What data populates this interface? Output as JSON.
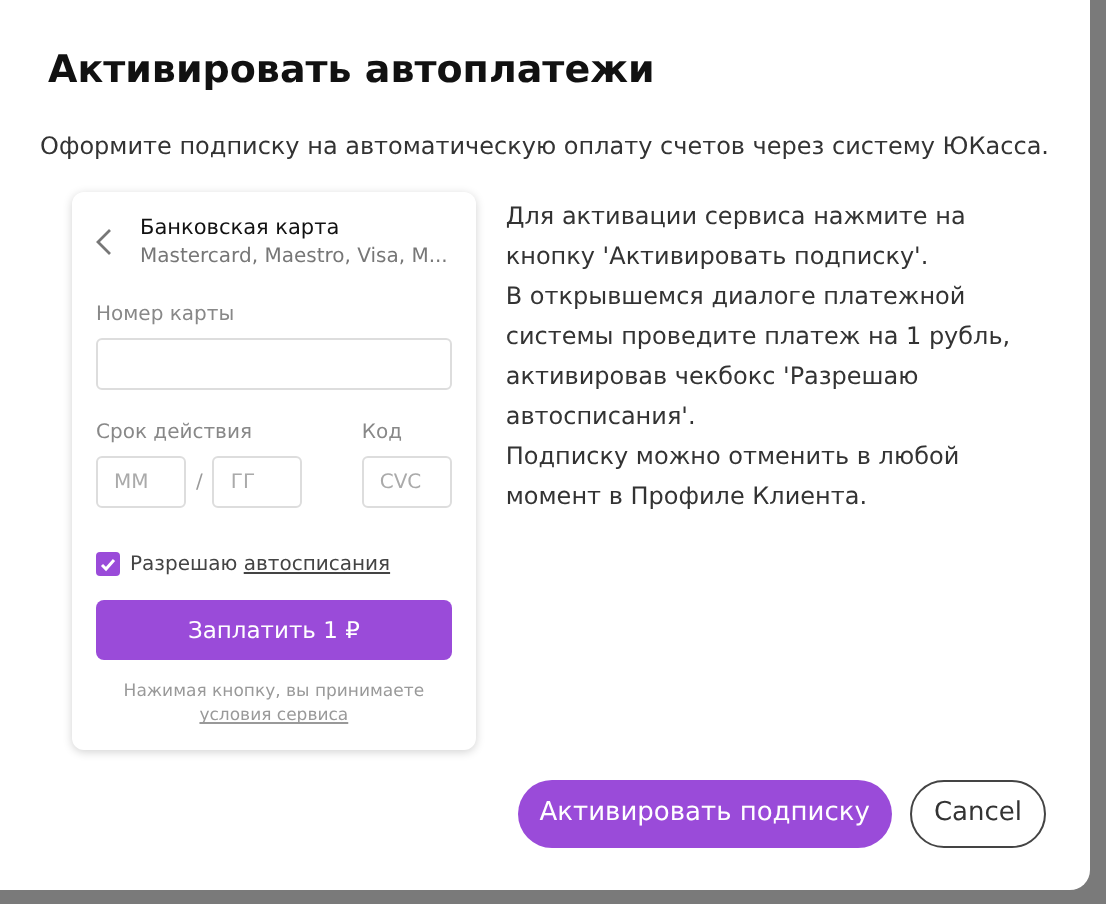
{
  "dialog": {
    "title": "Активировать автоплатежи",
    "description": "Оформите подписку на автоматическую оплату счетов через систему ЮКасса."
  },
  "payment_form": {
    "method_title": "Банковская карта",
    "method_subtitle": "Mastercard, Maestro, Visa, M...",
    "card_number_label": "Номер карты",
    "expiry_label": "Срок действия",
    "month_placeholder": "ММ",
    "separator": "/",
    "year_placeholder": "ГГ",
    "code_label": "Код",
    "code_placeholder": "CVC",
    "autopay": {
      "checked": true,
      "label": "Разрешаю",
      "link": "автосписания"
    },
    "pay_button": "Заплатить 1 ₽",
    "terms_text": "Нажимая кнопку, вы принимаете",
    "terms_link": "условия сервиса"
  },
  "instructions": [
    "Для активации сервиса нажмите на кнопку 'Активировать подписку'.",
    "В открывшемся диалоге платежной системы проведите платеж на 1 рубль, активировав чекбокс 'Разрешаю автосписания'.",
    "Подписку можно отменить в любой момент в Профиле Клиента."
  ],
  "buttons": [
    {
      "kind": "primary",
      "label": "Активировать подписку"
    },
    {
      "kind": "secondary",
      "label": "Cancel"
    }
  ]
}
